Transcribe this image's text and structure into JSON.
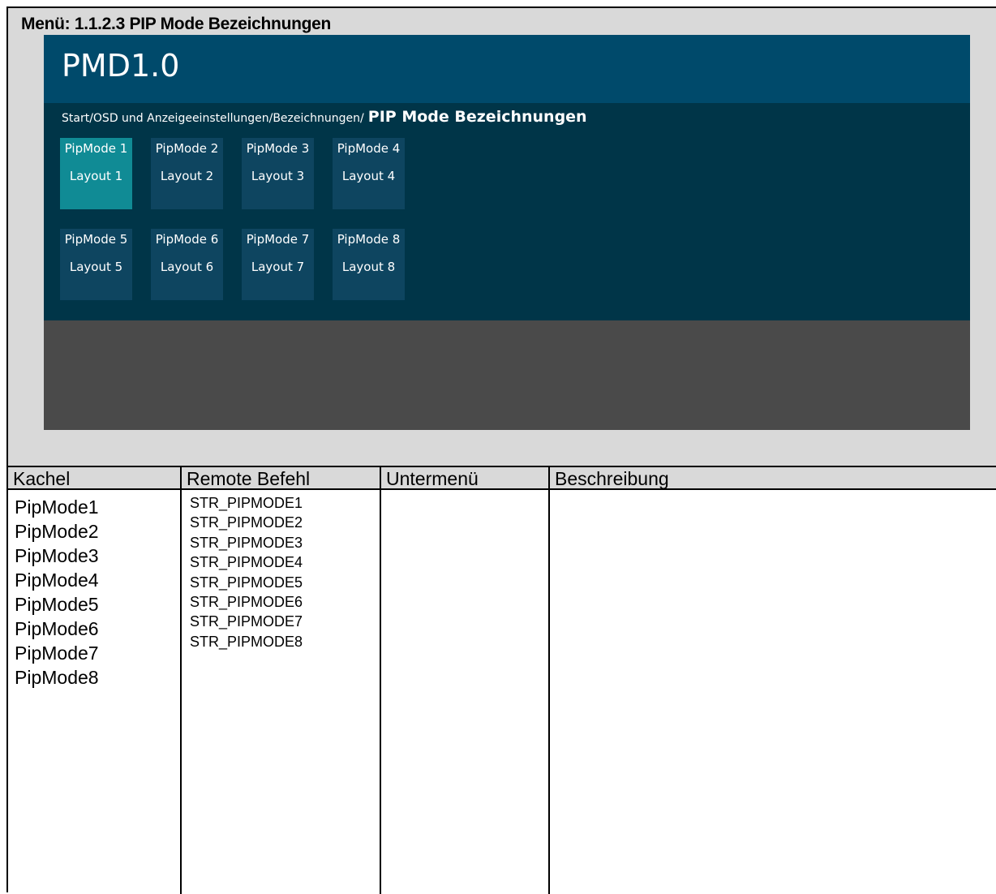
{
  "menu_title": "Menü: 1.1.2.3 PIP Mode Bezeichnungen",
  "app": {
    "title": "PMD1.0",
    "breadcrumb_path": "Start/OSD und Anzeigeeinstellungen/Bezeichnungen/",
    "breadcrumb_current": "PIP Mode Bezeichnungen"
  },
  "tiles": [
    {
      "name": "PipMode 1",
      "layout": "Layout 1",
      "active": true
    },
    {
      "name": "PipMode 2",
      "layout": "Layout 2",
      "active": false
    },
    {
      "name": "PipMode 3",
      "layout": "Layout 3",
      "active": false
    },
    {
      "name": "PipMode 4",
      "layout": "Layout 4",
      "active": false
    },
    {
      "name": "PipMode 5",
      "layout": "Layout 5",
      "active": false
    },
    {
      "name": "PipMode 6",
      "layout": "Layout 6",
      "active": false
    },
    {
      "name": "PipMode 7",
      "layout": "Layout 7",
      "active": false
    },
    {
      "name": "PipMode 8",
      "layout": "Layout 8",
      "active": false
    }
  ],
  "table": {
    "headers": [
      "Kachel",
      "Remote Befehl",
      "Untermenü",
      "Beschreibung"
    ],
    "kachel": [
      "PipMode1",
      "PipMode2",
      "PipMode3",
      "PipMode4",
      "PipMode5",
      "PipMode6",
      "PipMode7",
      "PipMode8"
    ],
    "remote": [
      "STR_PIPMODE1",
      "STR_PIPMODE2",
      "STR_PIPMODE3",
      "STR_PIPMODE4",
      "STR_PIPMODE5",
      "STR_PIPMODE6",
      "STR_PIPMODE7",
      "STR_PIPMODE8"
    ],
    "untermenu": "",
    "beschreibung": ""
  },
  "colors": {
    "header_bar": "#004a6b",
    "content_bg": "#003548",
    "tile_bg": "#0e4560",
    "tile_active": "#108b95",
    "footer_bg": "#4a4a4a",
    "panel_bg": "#d9d9d9"
  }
}
